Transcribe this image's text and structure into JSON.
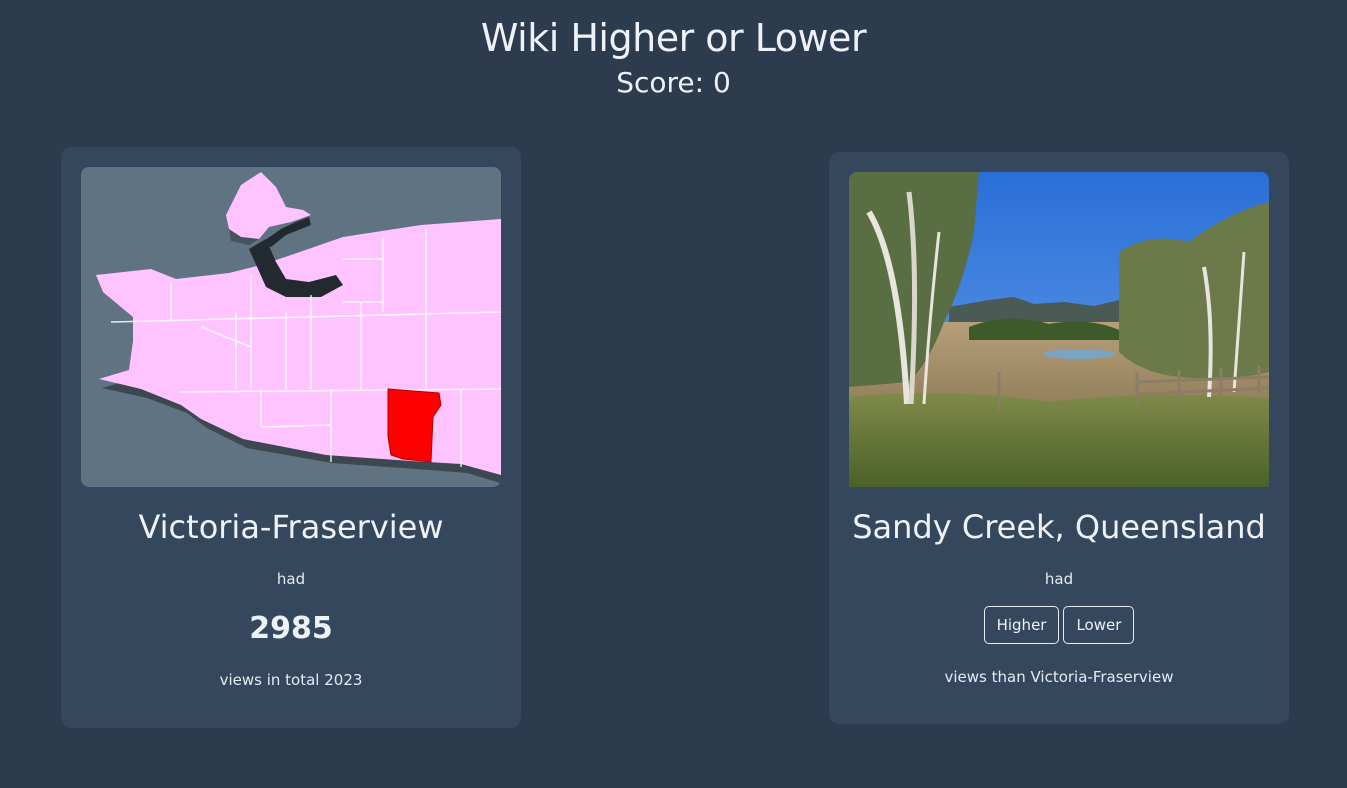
{
  "header": {
    "title": "Wiki Higher or Lower",
    "score_label": "Score: 0"
  },
  "left_card": {
    "name": "Victoria-Fraserview",
    "had_label": "had",
    "views": "2985",
    "caption": "views in total 2023",
    "image": "map-of-vancouver-neighbourhoods"
  },
  "right_card": {
    "name": "Sandy Creek, Queensland",
    "had_label": "had",
    "higher_label": "Higher",
    "lower_label": "Lower",
    "caption": "views than Victoria-Fraserview",
    "image": "rural-landscape-photo"
  },
  "colors": {
    "background": "#2d3b4e",
    "card": "#34475d",
    "map_region": "#ffc4ff",
    "map_highlight": "#ff0000",
    "map_water": "#5f7383"
  }
}
